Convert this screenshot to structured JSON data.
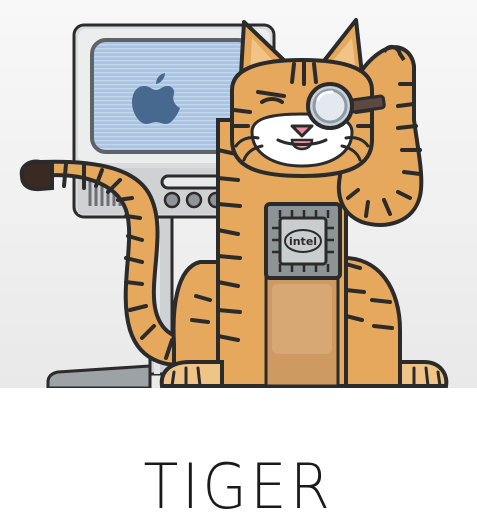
{
  "title": "TIGER",
  "chip_label": "intel",
  "colors": {
    "background_top": "#f7f7f7",
    "background_bottom": "#ebebeb",
    "outline": "#2b2b2b",
    "fur": "#e6a85c",
    "fur_light": "#f0c487",
    "fur_shadow": "#c98a44",
    "stripe": "#2b2b2b",
    "monitor_body": "#d6d8d9",
    "screen": "#a9c4e2",
    "apple_logo": "#47698f",
    "chip": "#b8bcbf",
    "magnifier": "#c8d2d9"
  }
}
